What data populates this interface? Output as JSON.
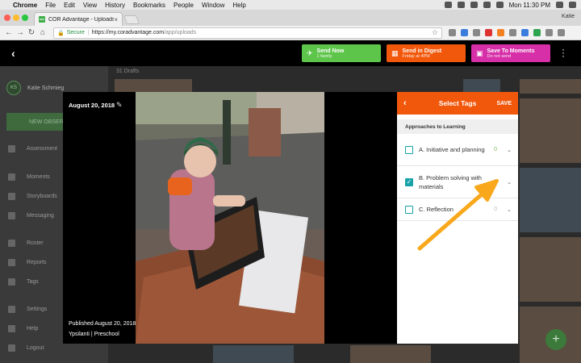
{
  "menubar": {
    "app": "Chrome",
    "items": [
      "File",
      "Edit",
      "View",
      "History",
      "Bookmarks",
      "People",
      "Window",
      "Help"
    ],
    "clock": "Mon 11:30 PM"
  },
  "browser": {
    "tab_title": "COR Advantage - Uploads",
    "profile": "Katie",
    "secure_label": "Secure",
    "url_host": "https://my.coradvantage.com",
    "url_path": "/app/uploads"
  },
  "actions": {
    "send_now": {
      "title": "Send Now",
      "sub": "1 family"
    },
    "send_digest": {
      "title": "Send in Digest",
      "sub": "Friday at 4PM"
    },
    "save_moments": {
      "title": "Save To Moments",
      "sub": "Do not send"
    }
  },
  "sidebar": {
    "initials": "KS",
    "user": "Katie Schmieg",
    "new_button": "NEW OBSERV...",
    "nav": [
      {
        "label": "Assessment"
      },
      {
        "label": "Moments"
      },
      {
        "label": "Storyboards"
      },
      {
        "label": "Messaging"
      },
      {
        "label": "Roster"
      },
      {
        "label": "Reports"
      },
      {
        "label": "Tags"
      },
      {
        "label": "Settings"
      },
      {
        "label": "Help"
      },
      {
        "label": "Logout"
      }
    ]
  },
  "content": {
    "drafts": "31 Drafts"
  },
  "modal": {
    "date": "August 20, 2018",
    "published": "Published August 20, 2018",
    "location": "Ypsilanti | Preschool"
  },
  "tags_panel": {
    "title": "Select Tags",
    "save": "SAVE",
    "section": "Approaches to Learning",
    "tags": [
      {
        "label": "A. Initiative and planning",
        "count": "0",
        "checked": false
      },
      {
        "label": "B. Problem solving with materials",
        "count": "0",
        "checked": true
      },
      {
        "label": "C. Reflection",
        "count": "0",
        "checked": false
      }
    ]
  },
  "colors": {
    "send_now": "#5dc54a",
    "send_digest": "#f2580c",
    "save_moments": "#d62fa8",
    "tags_header": "#f2580c",
    "checkbox": "#17a2a8",
    "annotation_arrow": "#f9a81b"
  }
}
